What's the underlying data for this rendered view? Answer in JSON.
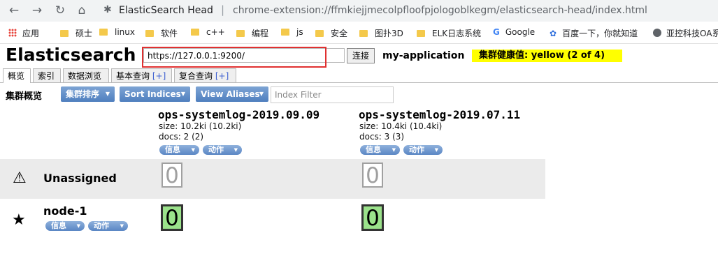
{
  "browser": {
    "back": "←",
    "forward": "→",
    "reload": "↻",
    "home": "⌂",
    "extension_icon": "puzzle-icon",
    "site_name": "ElasticSearch Head",
    "separator": "|",
    "url": "chrome-extension://ffmkiejjmecolpfloofpjologoblkegm/elasticsearch-head/index.html"
  },
  "bookmarks": [
    {
      "label": "应用",
      "icon": "apps-icon"
    },
    {
      "label": "硕士",
      "icon": "folder-icon"
    },
    {
      "label": "linux",
      "icon": "folder-icon"
    },
    {
      "label": "软件",
      "icon": "folder-icon"
    },
    {
      "label": "c++",
      "icon": "folder-icon"
    },
    {
      "label": "编程",
      "icon": "folder-icon"
    },
    {
      "label": "js",
      "icon": "folder-icon"
    },
    {
      "label": "安全",
      "icon": "folder-icon"
    },
    {
      "label": "图扑3D",
      "icon": "folder-icon"
    },
    {
      "label": "ELK日志系统",
      "icon": "folder-icon"
    },
    {
      "label": "Google",
      "icon": "google-icon"
    },
    {
      "label": "百度一下，你就知道",
      "icon": "baidu-icon"
    },
    {
      "label": "亚控科技OA系",
      "icon": "globe-icon"
    }
  ],
  "header": {
    "title": "Elasticsearch",
    "connection_url": "https://127.0.0.1:9200/",
    "connect_label": "连接",
    "cluster_name": "my-application",
    "health_text": "集群健康值: yellow (2 of 4)",
    "health_color": "#ffff00"
  },
  "tabs": [
    {
      "label": "概览",
      "plus": ""
    },
    {
      "label": "索引",
      "plus": ""
    },
    {
      "label": "数据浏览",
      "plus": ""
    },
    {
      "label": "基本查询",
      "plus": "[+]"
    },
    {
      "label": "复合查询",
      "plus": "[+]"
    }
  ],
  "toolbar": {
    "label": "集群概览",
    "sort_cluster": "集群排序",
    "sort_indices": "Sort Indices",
    "view_aliases": "View Aliases",
    "filter_placeholder": "Index Filter"
  },
  "indices": [
    {
      "name": "ops-systemlog-2019.09.09",
      "size": "size: 10.2ki (10.2ki)",
      "docs": "docs: 2 (2)",
      "info": "信息",
      "action": "动作"
    },
    {
      "name": "ops-systemlog-2019.07.11",
      "size": "size: 10.4ki (10.4ki)",
      "docs": "docs: 3 (3)",
      "info": "信息",
      "action": "动作"
    }
  ],
  "rows": {
    "unassigned": {
      "label": "Unassigned",
      "icon": "warning-icon",
      "shards": [
        "0",
        "0"
      ]
    },
    "node": {
      "label": "node-1",
      "icon": "star-icon",
      "info": "信息",
      "action": "动作",
      "shards": [
        "0",
        "0"
      ]
    }
  }
}
